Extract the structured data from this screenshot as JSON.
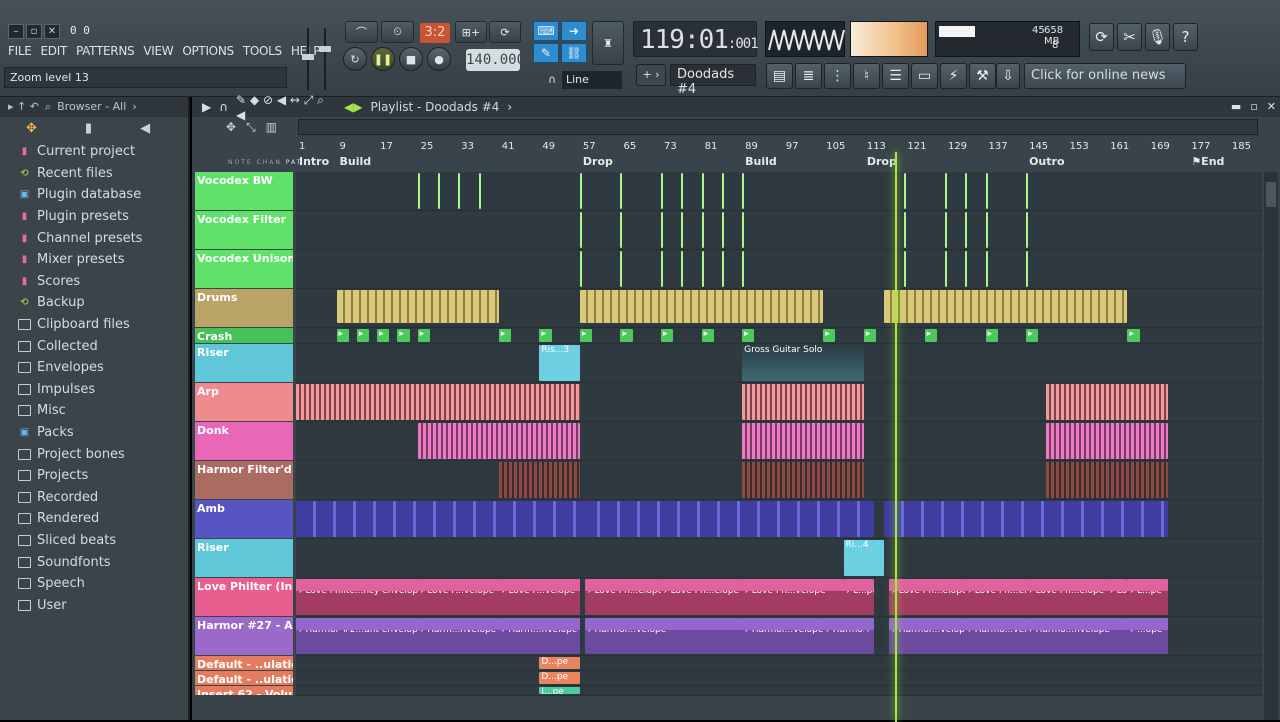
{
  "hint": "0   0",
  "menu": [
    "FILE",
    "EDIT",
    "PATTERNS",
    "VIEW",
    "OPTIONS",
    "TOOLS",
    "HELP"
  ],
  "zoom_label": "Zoom level 13",
  "beat_display": "3:2",
  "tempo": "140.000",
  "clock_main": "119:01",
  "clock_sub": ":001",
  "snap_mode": "Line",
  "pattern_name": "Doodads #4",
  "cpu_value": "45",
  "ram_value": "658 MB",
  "poly_value": "8",
  "news_label": "Click for online news",
  "browser": {
    "title": "Browser - All",
    "items": [
      {
        "label": "Current project",
        "icon": "pink"
      },
      {
        "label": "Recent files",
        "icon": "green"
      },
      {
        "label": "Plugin database",
        "icon": "blue"
      },
      {
        "label": "Plugin presets",
        "icon": "pink"
      },
      {
        "label": "Channel presets",
        "icon": "pink"
      },
      {
        "label": "Mixer presets",
        "icon": "pink"
      },
      {
        "label": "Scores",
        "icon": "pink"
      },
      {
        "label": "Backup",
        "icon": "green"
      },
      {
        "label": "Clipboard files",
        "icon": "gray"
      },
      {
        "label": "Collected",
        "icon": "gray"
      },
      {
        "label": "Envelopes",
        "icon": "gray"
      },
      {
        "label": "Impulses",
        "icon": "gray"
      },
      {
        "label": "Misc",
        "icon": "gray"
      },
      {
        "label": "Packs",
        "icon": "blue"
      },
      {
        "label": "Project bones",
        "icon": "gray"
      },
      {
        "label": "Projects",
        "icon": "gray"
      },
      {
        "label": "Recorded",
        "icon": "gray"
      },
      {
        "label": "Rendered",
        "icon": "gray"
      },
      {
        "label": "Sliced beats",
        "icon": "gray"
      },
      {
        "label": "Soundfonts",
        "icon": "gray"
      },
      {
        "label": "Speech",
        "icon": "gray"
      },
      {
        "label": "User",
        "icon": "gray"
      }
    ]
  },
  "playlist": {
    "title": "Playlist - Doodads #4",
    "ruler_numbers": [
      "1",
      "9",
      "17",
      "25",
      "33",
      "41",
      "49",
      "57",
      "65",
      "73",
      "81",
      "89",
      "97",
      "105",
      "113",
      "121",
      "129",
      "137",
      "145",
      "153",
      "161",
      "169",
      "177",
      "185"
    ],
    "markers": [
      "Intro",
      "Build",
      "Drop",
      "Build",
      "Drop",
      "Outro",
      "End"
    ],
    "header_labels": [
      "NOTE",
      "CHAN",
      "PAT"
    ],
    "tracks": [
      {
        "name": "Vocodex BW",
        "color": "#5fe16a",
        "height": 39
      },
      {
        "name": "Vocodex Filter",
        "color": "#5fe16a",
        "height": 39
      },
      {
        "name": "Vocodex Unison",
        "color": "#5fe16a",
        "height": 39
      },
      {
        "name": "Drums",
        "color": "#b9a466",
        "height": 39
      },
      {
        "name": "Crash",
        "color": "#48c05a",
        "height": 16
      },
      {
        "name": "Riser",
        "color": "#5fc7d8",
        "height": 39
      },
      {
        "name": "Arp",
        "color": "#f08a8e",
        "height": 39
      },
      {
        "name": "Donk",
        "color": "#e868b7",
        "height": 39
      },
      {
        "name": "Harmor Filter'd",
        "color": "#ab6a62",
        "height": 39
      },
      {
        "name": "Amb",
        "color": "#5755c2",
        "height": 39
      },
      {
        "name": "Riser",
        "color": "#5fc7d8",
        "height": 39
      },
      {
        "name": "Love Philter (Insert...",
        "color": "#e85e8e",
        "height": 39
      },
      {
        "name": "Harmor #27 - A - P...",
        "color": "#9b69c9",
        "height": 39
      },
      {
        "name": "Default - ..ulation X",
        "color": "#e47d5f",
        "height": 15
      },
      {
        "name": "Default - ..ulation X",
        "color": "#e47d5f",
        "height": 15
      },
      {
        "name": "Insert 62 - Volume",
        "color": "#e47d5f",
        "height": 10
      }
    ],
    "clips": {
      "riser1": "Ris...3",
      "gross": "Gross Guitar Solo",
      "riser2": "Ri...4",
      "love": [
        "Love Philte...ncy envelope",
        "Love P...velope",
        "Love P...velope",
        "Love Ph...elope",
        "Love Ph...elope",
        "Love Ph...velope",
        "L...pe",
        "Love Ph...elope",
        "Love Ph...elope",
        "Love Ph...elope",
        "Love Ph...velope",
        "L...pe"
      ],
      "harmor": [
        "Harmor #2...unt envelope",
        "Harm...nvelope",
        "Harm...nvelope",
        "Harmor...velope",
        "Harmor...velope",
        "Harmo...velope",
        "...ope",
        "Harmor...velope",
        "Harmo...velope",
        "Harmo...nvelope",
        "...ope"
      ],
      "default1": "D...pe",
      "default2": "D...pe",
      "insert": "I...pe"
    }
  }
}
